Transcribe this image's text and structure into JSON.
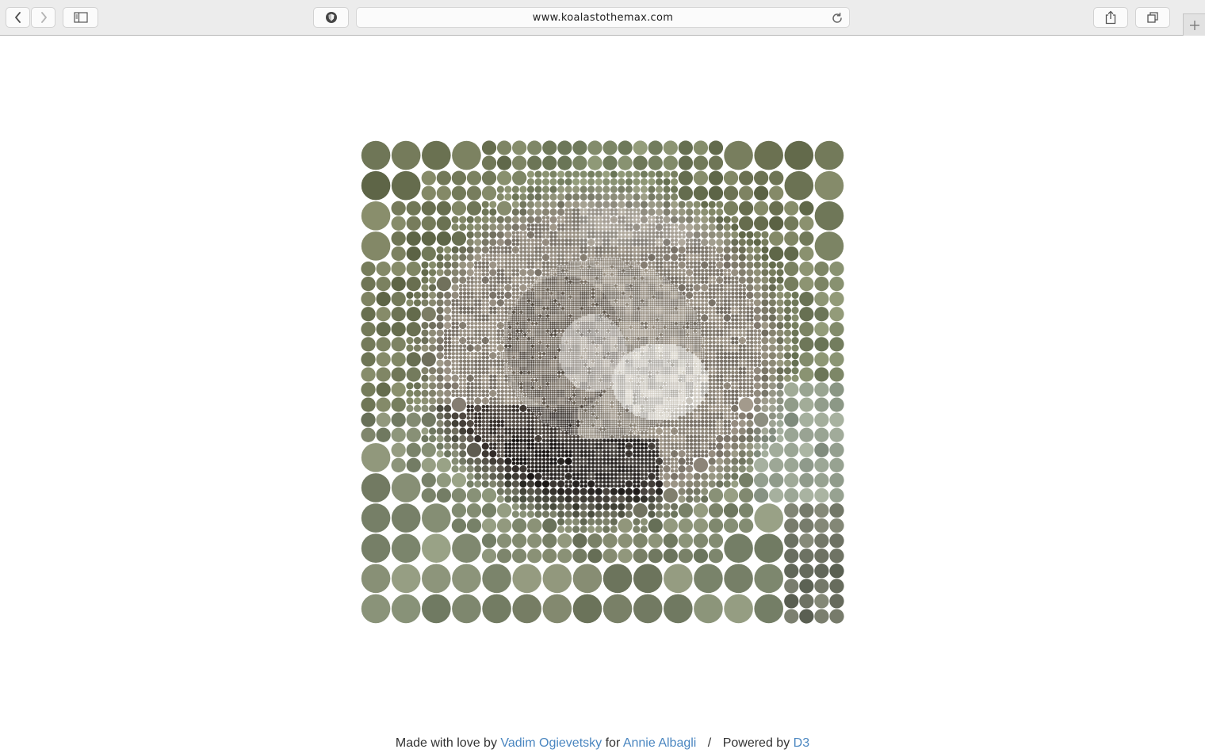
{
  "browser": {
    "url": "www.koalastothemax.com"
  },
  "footer": {
    "made_with_love_by": "Made with love by",
    "author": "Vadim Ogievetsky",
    "for": "for",
    "recipient": "Annie Albagli",
    "separator": "/",
    "powered_by": "Powered by",
    "library": "D3"
  },
  "mosaic": {
    "palette_hex": {
      "bg_green": "#7f8a6a",
      "bg_olive": "#6f7552",
      "bg_grey": "#9aa096",
      "koala_grey": "#8b8478",
      "koala_dark": "#3b3430",
      "koala_light": "#d6d2cc"
    }
  },
  "colors": {
    "link": "#4a86c0",
    "toolbar_bg": "#ececec"
  }
}
